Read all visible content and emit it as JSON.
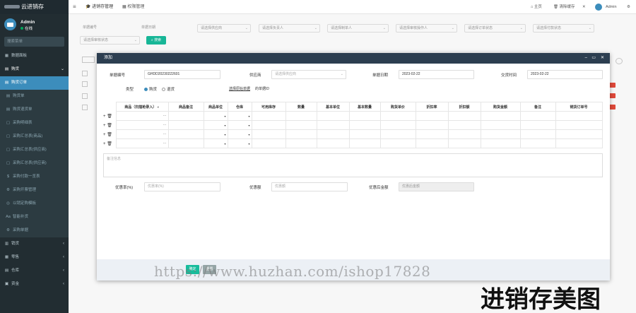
{
  "app": {
    "brand": "云进销存",
    "user_name": "Admin",
    "user_status": "在线",
    "search_placeholder": "搜索菜单"
  },
  "sidebar": {
    "items": [
      {
        "label": "数据面板",
        "icon": "dashboard-icon"
      },
      {
        "label": "购货",
        "icon": "cart-icon"
      },
      {
        "label": "购货订单"
      },
      {
        "label": "购货单"
      },
      {
        "label": "购货退货单"
      },
      {
        "label": "采购明细表"
      },
      {
        "label": "采购汇总表(商品)"
      },
      {
        "label": "采购汇总表(供应商)"
      },
      {
        "label": "采购汇总表(供应商)"
      },
      {
        "label": "采购付款一览表"
      },
      {
        "label": "采购开票管理"
      },
      {
        "label": "以销定购模板"
      },
      {
        "label": "智能补货"
      },
      {
        "label": "采购单据"
      },
      {
        "label": "销货"
      },
      {
        "label": "零售"
      },
      {
        "label": "仓库"
      },
      {
        "label": "资金"
      }
    ]
  },
  "topbar": {
    "tabs": [
      {
        "label": "进销存管理"
      },
      {
        "label": "权限管理"
      }
    ],
    "right": {
      "home": "主页",
      "clear_cache": "清除缓存",
      "user": "Admin"
    }
  },
  "filters": {
    "order_no": "单据编号",
    "order_date": "单据日期",
    "supplier_ph": "请选择供应商",
    "handler_ph": "请选择负责人",
    "maker_ph": "请选择制单人",
    "reviewer_ph": "请选择审核操作人",
    "order_status_ph": "请选择订单状态",
    "pay_status_ph": "请选择付款状态",
    "review_status_ph": "请选择审核状态",
    "search_btn": "搜索"
  },
  "modal": {
    "title": "添加",
    "fields": {
      "order_no_label": "单据编号",
      "order_no_value": "GHDD20230222601",
      "supplier_label": "供应商",
      "supplier_ph": "请选择供应商",
      "order_date_label": "单据日期",
      "order_date_value": "2023-02-22",
      "delivery_label": "交货时间",
      "delivery_value": "2023-02-22",
      "type_label": "类型",
      "type_opt1": "购货",
      "type_opt2": "退货",
      "select_link": "选择原始单据",
      "select_suffix": "的单据ID"
    },
    "columns": [
      "商品（扫描枪录入）",
      "商品备注",
      "商品单位",
      "仓库",
      "可用库存",
      "数量",
      "基本单位",
      "基本数量",
      "购货单价",
      "折扣率",
      "折扣额",
      "购货金额",
      "备注",
      "销货订单号"
    ],
    "rows": 4,
    "remark_ph": "备注信息",
    "discount_rate_label": "优惠率(%)",
    "discount_rate_ph": "优惠率(%)",
    "discount_amt_label": "优惠额",
    "discount_amt_ph": "优惠额",
    "after_amt_label": "优惠后金额",
    "after_amt_ph": "优惠后金额",
    "ok_btn": "确定",
    "reset_btn": "重置"
  },
  "watermark": {
    "url": "https://www.huzhan.com/ishop17828",
    "caption": "进销存美图"
  }
}
